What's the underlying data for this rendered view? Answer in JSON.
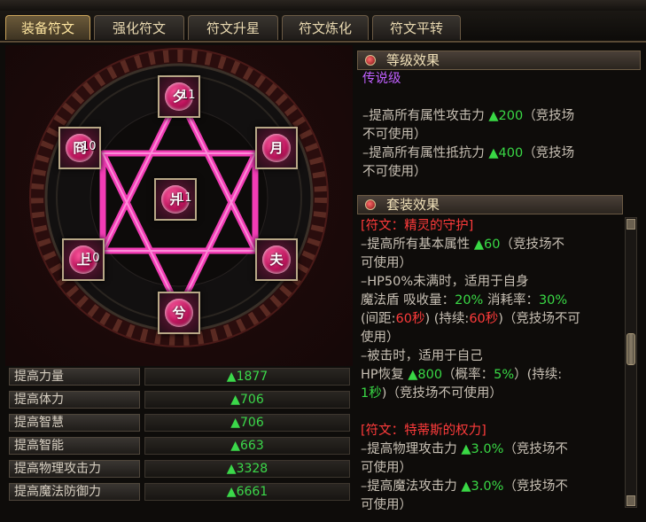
{
  "tabs": [
    "装备符文",
    "强化符文",
    "符文升星",
    "符文炼化",
    "符文平转"
  ],
  "active_tab": 0,
  "runes": [
    {
      "id": "top",
      "glyph": "夕",
      "level": "11"
    },
    {
      "id": "upper-left",
      "glyph": "冏",
      "level": "10"
    },
    {
      "id": "upper-right",
      "glyph": "月",
      "level": ""
    },
    {
      "id": "center",
      "glyph": "爿",
      "level": "11"
    },
    {
      "id": "lower-left",
      "glyph": "上",
      "level": "10"
    },
    {
      "id": "lower-right",
      "glyph": "夫",
      "level": ""
    },
    {
      "id": "bottom",
      "glyph": "兮",
      "level": ""
    }
  ],
  "stats": [
    {
      "label": "提高力量",
      "value": "▲1877"
    },
    {
      "label": "提高体力",
      "value": "▲706"
    },
    {
      "label": "提高智慧",
      "value": "▲706"
    },
    {
      "label": "提高智能",
      "value": "▲663"
    },
    {
      "label": "提高物理攻击力",
      "value": "▲3328"
    },
    {
      "label": "提高魔法防御力",
      "value": "▲6661"
    }
  ],
  "level_effect": {
    "header": "等级效果",
    "grade": "传说级",
    "l1_pre": "–提高所有属性攻击力 ",
    "l1_val": "▲200",
    "l1_post": "（竞技场",
    "l1_cont": "不可使用）",
    "l2_pre": "–提高所有属性抵抗力 ",
    "l2_val": "▲400",
    "l2_post": "（竞技场",
    "l2_cont": "不可使用）"
  },
  "set_effect": {
    "header": "套装效果",
    "set1_name": "[符文：精灵的守护]",
    "s1_pre": " –提高所有基本属性 ",
    "s1_val": "▲60",
    "s1_post": "（竞技场不",
    "s1_cont": "可使用）",
    "s2": " –HP50%未满时，适用于自身",
    "s3_a": "  魔法盾 吸收量：",
    "s3_b": "20%",
    "s3_c": " 消耗率：",
    "s3_d": "30%",
    "s4_a": "(间距:",
    "s4_b": "60秒",
    "s4_c": ") (持续:",
    "s4_d": "60秒",
    "s4_e": ")（竞技场不可",
    "s4_cont": "使用）",
    "s5": " –被击时，适用于自己",
    "s6_a": "  HP恢复 ",
    "s6_b": "▲800",
    "s6_c": "（概率：",
    "s6_d": "5%",
    "s6_e": "）(持续:",
    "s7_a": "1秒",
    "s7_b": ")（竞技场不可使用）",
    "set2_name": "[符文：特蒂斯的权力]",
    "t1_pre": " –提高物理攻击力 ",
    "t1_val": "▲3.0%",
    "t1_post": "（竞技场不",
    "t1_cont": "可使用）",
    "t2_pre": " –提高魔法攻击力 ",
    "t2_val": "▲3.0%",
    "t2_post": "（竞技场不",
    "t2_cont": "可使用）"
  },
  "colors": {
    "accent_pink": "#ff3fbf",
    "value_green": "#39d845",
    "set_name_red": "#ff3b3b",
    "grade_purple": "#c060ff"
  }
}
